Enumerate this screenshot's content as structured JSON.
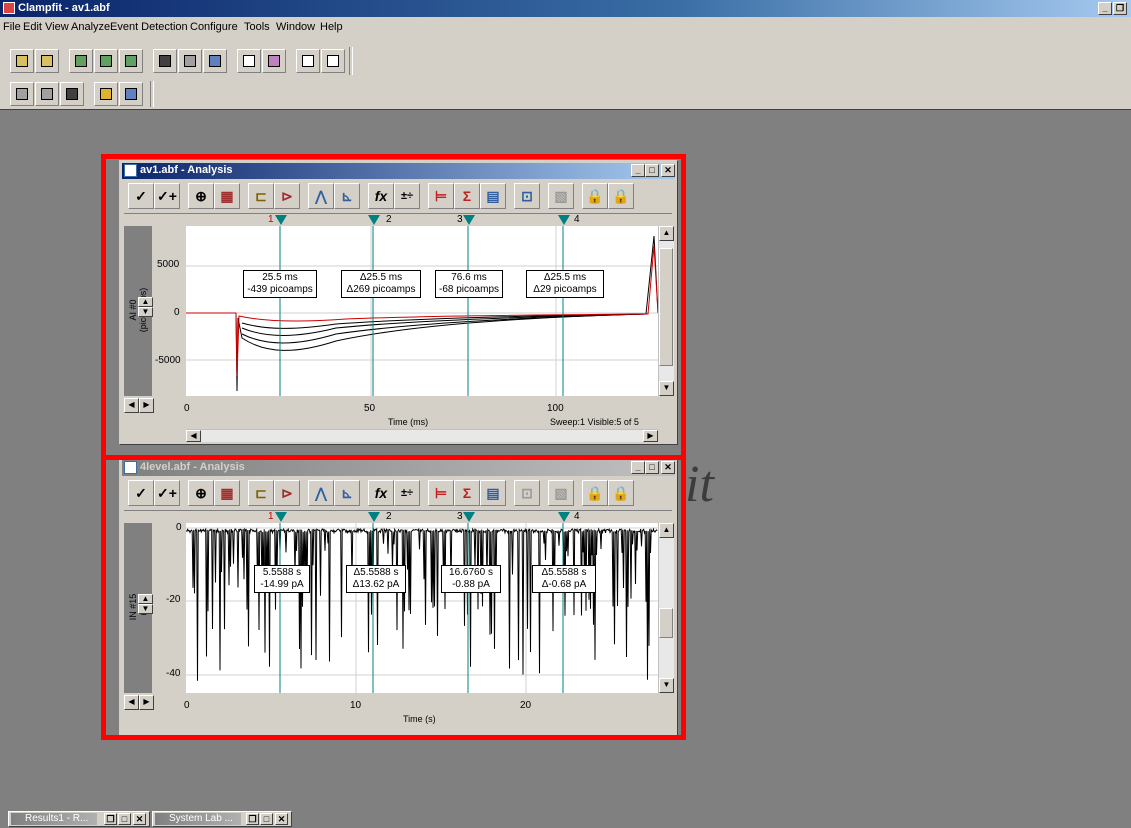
{
  "app": {
    "title": "Clampfit - av1.abf",
    "watermark": "it"
  },
  "menu": [
    "File",
    "Edit",
    "View",
    "Analyze",
    "Event Detection",
    "Configure",
    "Tools",
    "Window",
    "Help"
  ],
  "icons": {
    "app": "clampfit-app-icon",
    "check": "✓",
    "check_plus": "✓+",
    "zoom": "⊕",
    "fx": "fx",
    "ops": "±÷"
  },
  "colors": {
    "highlight": "#ff0000",
    "cursor_line": "#008080",
    "trace_dark": "#000000",
    "trace_red": "#cc0000"
  },
  "windows": [
    {
      "title": "av1.abf - Analysis",
      "active": true,
      "cursors": [
        "1",
        "2",
        "3",
        "4"
      ],
      "readouts": [
        {
          "line1": "25.5 ms",
          "line2": "-439 picoamps"
        },
        {
          "line1": "Δ25.5 ms",
          "line2": "Δ269 picoamps"
        },
        {
          "line1": "76.6 ms",
          "line2": "-68 picoamps"
        },
        {
          "line1": "Δ25.5 ms",
          "line2": "Δ29 picoamps"
        }
      ],
      "y_ticks": [
        "5000",
        "0",
        "-5000"
      ],
      "x_ticks": [
        "0",
        "50",
        "100"
      ],
      "y_label": "AI #0\n(picoamps)",
      "x_label": "Time (ms)",
      "status": "Sweep:1 Visible:5 of 5"
    },
    {
      "title": "4level.abf - Analysis",
      "active": false,
      "cursors": [
        "1",
        "2",
        "3",
        "4"
      ],
      "readouts": [
        {
          "line1": "5.5588 s",
          "line2": "-14.99 pA"
        },
        {
          "line1": "Δ5.5588 s",
          "line2": "Δ13.62 pA"
        },
        {
          "line1": "16.6760 s",
          "line2": "-0.88 pA"
        },
        {
          "line1": "Δ5.5588 s",
          "line2": "Δ-0.68 pA"
        }
      ],
      "y_ticks": [
        "0",
        "-20",
        "-40"
      ],
      "x_ticks": [
        "0",
        "10",
        "20"
      ],
      "y_label": "IN #15\n(pA)",
      "x_label": "Time (s)"
    }
  ],
  "taskbar": [
    {
      "label": "Results1 - R..."
    },
    {
      "label": "System Lab ..."
    }
  ]
}
